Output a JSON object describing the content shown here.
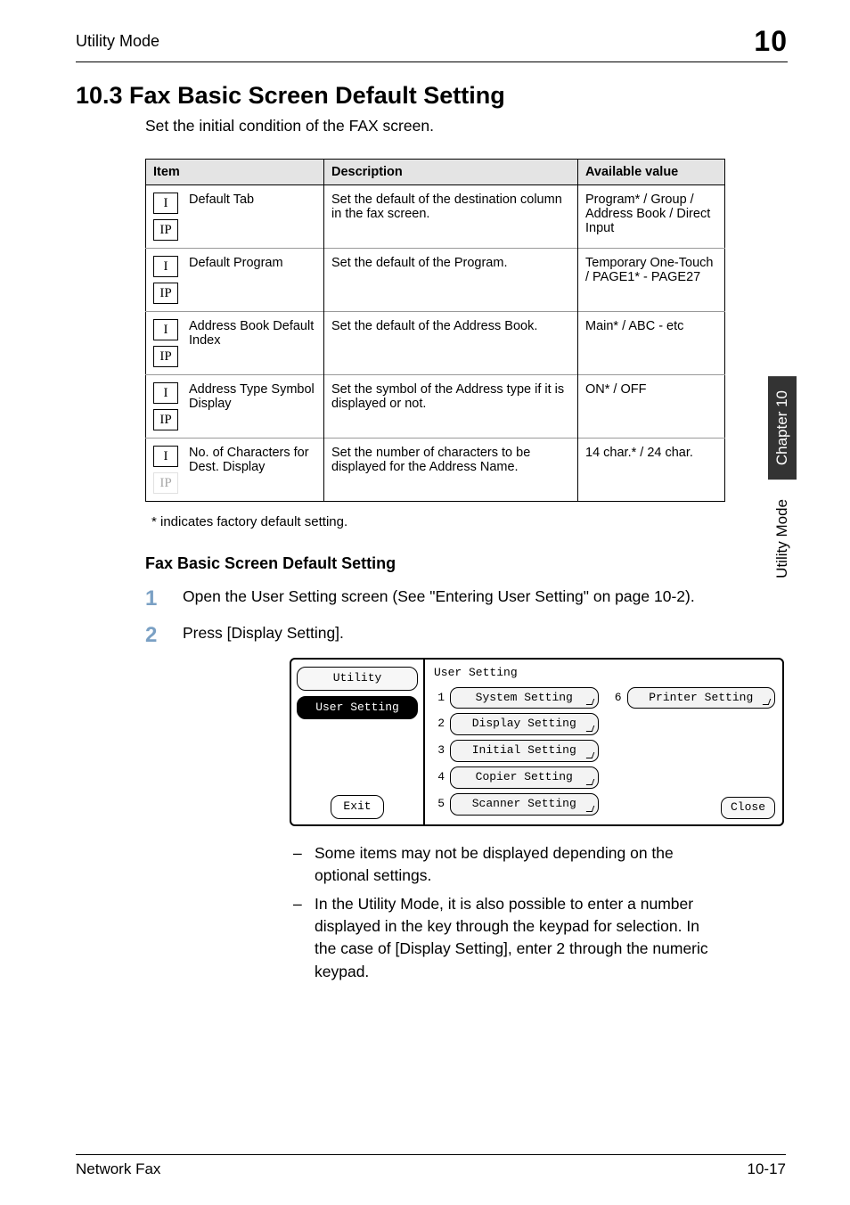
{
  "header": {
    "running": "Utility Mode",
    "chapter_number": "10"
  },
  "section": {
    "number_title": "10.3   Fax Basic Screen Default Setting",
    "intro": "Set the initial condition of the FAX screen."
  },
  "table": {
    "headers": {
      "item": "Item",
      "description": "Description",
      "available": "Available value"
    },
    "rows": [
      {
        "ip_faded": false,
        "item": "Default Tab",
        "description": "Set the default of the destination column in the fax screen.",
        "available": "Program* / Group / Address Book / Direct Input"
      },
      {
        "ip_faded": false,
        "item": "Default Program",
        "description": "Set the default of the Program.",
        "available": "Temporary One-Touch / PAGE1* - PAGE27"
      },
      {
        "ip_faded": false,
        "item": "Address Book Default Index",
        "description": "Set the default of the Address Book.",
        "available": "Main* / ABC - etc"
      },
      {
        "ip_faded": false,
        "item": "Address Type Symbol Display",
        "description": "Set the symbol of the Address type if it is displayed or not.",
        "available": "ON* / OFF"
      },
      {
        "ip_faded": true,
        "item": "No. of Characters for Dest. Display",
        "description": "Set the number of characters to be displayed for the Address Name.",
        "available": "14 char.* / 24 char."
      }
    ]
  },
  "footnote": "* indicates factory default setting.",
  "subhead": "Fax Basic Screen Default Setting",
  "steps": {
    "s1": "Open the User Setting screen (See \"Entering User Setting\" on page 10-2).",
    "s2": "Press [Display Setting]."
  },
  "screen": {
    "side_title": "Utility",
    "side_selected": "User Setting",
    "side_exit": "Exit",
    "main_title": "User Setting",
    "options": {
      "o1": "System Setting",
      "o2": "Display Setting",
      "o3": "Initial Setting",
      "o4": "Copier Setting",
      "o5": "Scanner Setting",
      "o6": "Printer Setting"
    },
    "close": "Close"
  },
  "notes": {
    "n1": "Some items may not be displayed depending on the optional settings.",
    "n2": "In the Utility Mode, it is also possible to enter a number displayed in the key through the keypad for selection. In the case of [Display Setting], enter 2 through the numeric keypad."
  },
  "side_tab": {
    "chapter": "Chapter 10",
    "utility": "Utility Mode"
  },
  "footer": {
    "left": "Network Fax",
    "right": "10-17"
  }
}
